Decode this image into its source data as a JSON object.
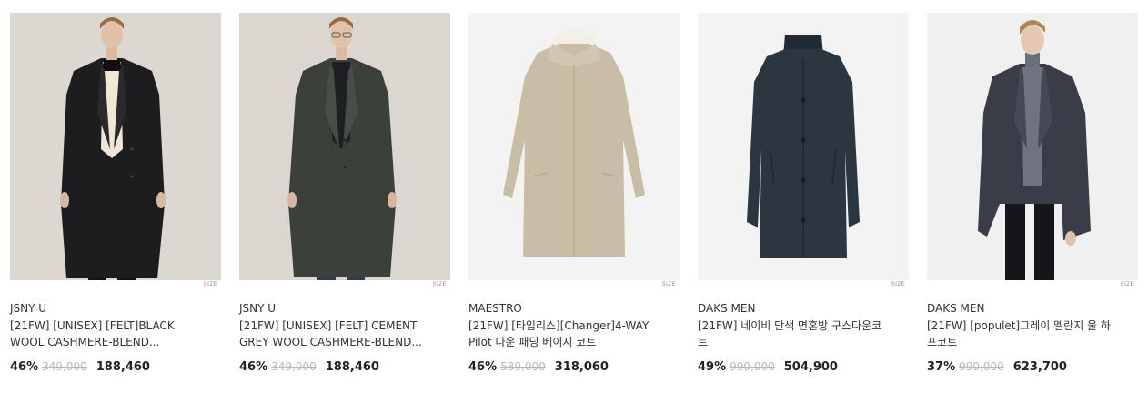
{
  "products": [
    {
      "brand": "JSNY U",
      "name": "[21FW] [UNISEX] [FELT]BLACK WOOL CASHMERE-BLEND...",
      "discount": "46%",
      "original_price": "349,000",
      "price": "188,460",
      "size_tag": "SIZE",
      "image": "man-black-coat"
    },
    {
      "brand": "JSNY U",
      "name": "[21FW] [UNISEX] [FELT] CEMENT GREY WOOL CASHMERE-BLEND...",
      "discount": "46%",
      "original_price": "349,000",
      "price": "188,460",
      "size_tag": "SIZE",
      "image": "man-grey-coat"
    },
    {
      "brand": "MAESTRO",
      "name": "[21FW] [타임리스][Changer]4-WAY Pilot 다운 패딩 베이지 코트",
      "discount": "46%",
      "original_price": "589,000",
      "price": "318,060",
      "size_tag": "SIZE",
      "image": "beige-coat-flat"
    },
    {
      "brand": "DAKS MEN",
      "name": "[21FW] 네이비 단색 면혼방 구스다운코트",
      "discount": "49%",
      "original_price": "990,000",
      "price": "504,900",
      "size_tag": "SIZE",
      "image": "navy-coat-flat"
    },
    {
      "brand": "DAKS MEN",
      "name": "[21FW] [populet]그레이 멜란지 울 하프코트",
      "discount": "37%",
      "original_price": "990,000",
      "price": "623,700",
      "size_tag": "SIZE",
      "image": "man-charcoal-coat"
    }
  ]
}
